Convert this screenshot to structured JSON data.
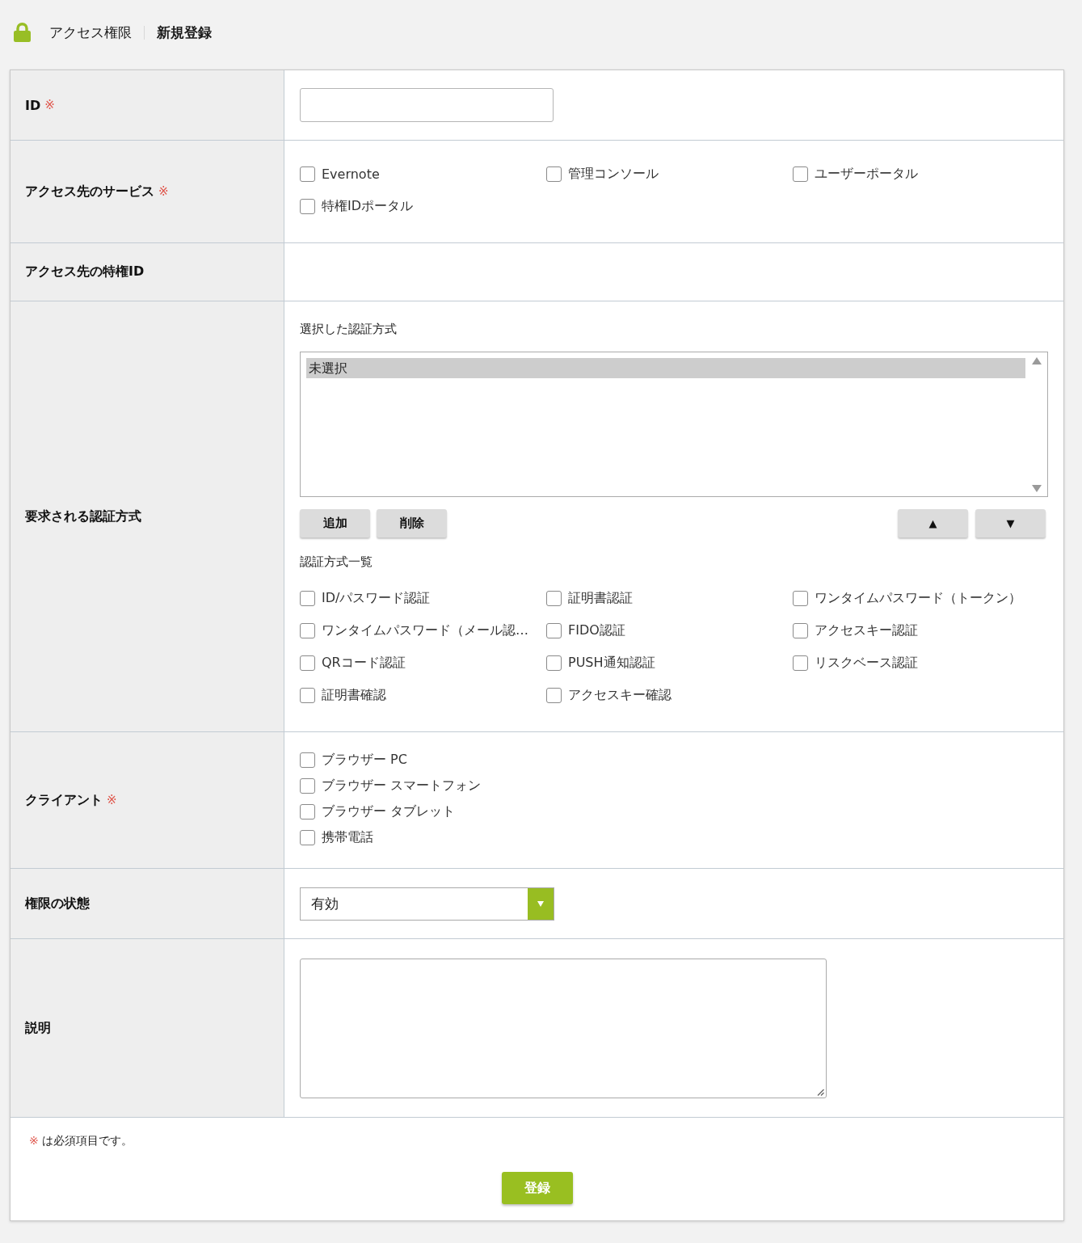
{
  "breadcrumb": [
    {
      "label": "アクセス権限"
    },
    {
      "label": "新規登録"
    }
  ],
  "rows": [
    {
      "kind": "text",
      "label": "ID",
      "mark": "※"
    },
    {
      "kind": "checkbox_grid",
      "label": "アクセス先のサービス",
      "mark": "※",
      "options": [
        {
          "label": "Evernote",
          "checked": false
        },
        {
          "label": "管理コンソール",
          "checked": false
        },
        {
          "label": "ユーザーポータル",
          "checked": false
        },
        {
          "label": "特権IDポータル",
          "checked": false
        }
      ]
    },
    {
      "kind": "empty",
      "label": "アクセス先の特権ID"
    },
    {
      "kind": "auth_methods",
      "label": "要求される認証方式",
      "selected_heading": "選択した認証方式",
      "selected_items": [
        {
          "label": "未選択",
          "selected": true
        }
      ],
      "edit_buttons": [
        "追加",
        "削除"
      ],
      "order_buttons": [
        "▲",
        "▼"
      ],
      "list_heading": "認証方式一覧",
      "options": [
        {
          "label": "ID/パスワード認証",
          "checked": false
        },
        {
          "label": "証明書認証",
          "checked": false
        },
        {
          "label": "ワンタイムパスワード（トークン）",
          "checked": false
        },
        {
          "label": "ワンタイムパスワード（メール認…",
          "checked": false
        },
        {
          "label": "FIDO認証",
          "checked": false
        },
        {
          "label": "アクセスキー認証",
          "checked": false
        },
        {
          "label": "QRコード認証",
          "checked": false
        },
        {
          "label": "PUSH通知認証",
          "checked": false
        },
        {
          "label": "リスクベース認証",
          "checked": false
        },
        {
          "label": "証明書確認",
          "checked": false
        },
        {
          "label": "アクセスキー確認",
          "checked": false
        }
      ]
    },
    {
      "kind": "checkbox_list",
      "label": "クライアント",
      "mark": "※",
      "options": [
        {
          "label": "ブラウザー PC",
          "checked": false
        },
        {
          "label": "ブラウザー スマートフォン",
          "checked": false
        },
        {
          "label": "ブラウザー タブレット",
          "checked": false
        },
        {
          "label": "携帯電話",
          "checked": false
        }
      ]
    },
    {
      "kind": "select",
      "label": "権限の状態",
      "value": "有効"
    },
    {
      "kind": "textarea",
      "label": "説明"
    }
  ],
  "footer": {
    "note": {
      "mark": "※",
      "text": "は必須項目です。"
    },
    "submit_button": "登録"
  }
}
